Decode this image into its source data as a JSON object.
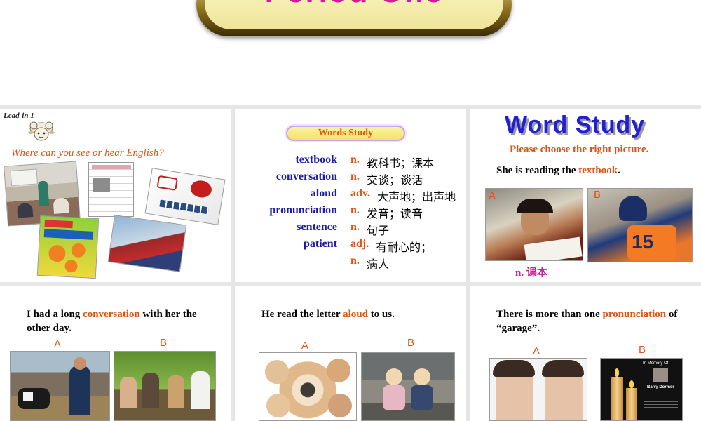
{
  "header": {
    "title": "Period One"
  },
  "slide1": {
    "lead_label": "Lead-in 1",
    "question": "Where can you see or hear English?"
  },
  "slide2": {
    "banner": "Words  Study",
    "vocab": [
      {
        "word": "textbook",
        "pos": "n.",
        "meaning": "教科书；课本"
      },
      {
        "word": "conversation",
        "pos": "n.",
        "meaning": "交谈；谈话"
      },
      {
        "word": "aloud",
        "pos": "adv.",
        "meaning": "大声地；出声地"
      },
      {
        "word": "pronunciation",
        "pos": "n.",
        "meaning": "发音；读音"
      },
      {
        "word": "sentence",
        "pos": "n.",
        "meaning": "句子"
      },
      {
        "word": "patient",
        "pos": "adj.",
        "meaning": "有耐心的；"
      },
      {
        "word": "",
        "pos": "n.",
        "meaning": "病人"
      }
    ]
  },
  "slide3": {
    "title": "Word Study",
    "instruction": "Please choose the right picture.",
    "sentence_before": "She is reading the ",
    "sentence_word": "textbook",
    "sentence_after": ".",
    "label_a": "A",
    "label_b": "B",
    "answer_pos": "n.",
    "answer_meaning": "课本"
  },
  "slide4": {
    "sentence_before": "I had a long ",
    "sentence_word": "conversation",
    "sentence_after": " with her the other day.",
    "label_a": "A",
    "label_b": "B"
  },
  "slide5": {
    "sentence_before": "He read the letter ",
    "sentence_word": "aloud",
    "sentence_after": " to us.",
    "label_a": "A",
    "label_b": "B"
  },
  "slide6": {
    "sentence_before": "There is more than one ",
    "sentence_word": "pronunciation",
    "sentence_after": " of “garage”.",
    "label_a": "A",
    "label_b": "B",
    "memorial_heading": "In Memory Of",
    "memorial_name": "Barry Dormer"
  },
  "colors": {
    "accent": "#e0520f",
    "vocab_word": "#1b1ba8",
    "title_pink": "#d31a9a",
    "word_study_blue": "#1f1fd6"
  }
}
